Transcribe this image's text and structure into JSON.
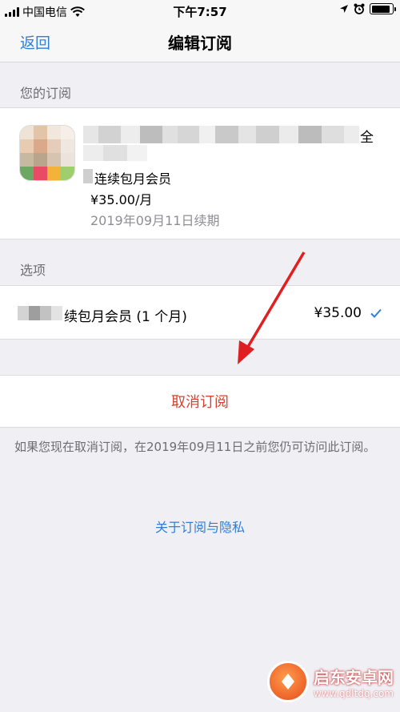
{
  "status": {
    "carrier": "中国电信",
    "time": "下午7:57",
    "battery_level": 0.9
  },
  "nav": {
    "back_label": "返回",
    "title": "编辑订阅"
  },
  "subscription_section": {
    "header": "您的订阅",
    "title_suffix": "全",
    "plan_name": "连续包月会员",
    "price": "¥35.00/月",
    "renewal": "2019年09月11日续期"
  },
  "options_section": {
    "header": "选项",
    "option_label": "续包月会员 (1 个月)",
    "option_price": "¥35.00",
    "selected": true
  },
  "cancel": {
    "label": "取消订阅"
  },
  "footnote": "如果您现在取消订阅，在2019年09月11日之前您仍可访问此订阅。",
  "privacy_link": "关于订阅与隐私",
  "watermark": {
    "title": "启东安卓网",
    "url": "www.qdltdq.com"
  },
  "colors": {
    "accent": "#2f7fd8",
    "destructive": "#d8402f",
    "annotation_arrow": "#e02020"
  },
  "icons": [
    "signal-icon",
    "wifi-icon",
    "location-icon",
    "alarm-icon",
    "battery-icon",
    "checkmark-icon",
    "annotation-arrow"
  ]
}
